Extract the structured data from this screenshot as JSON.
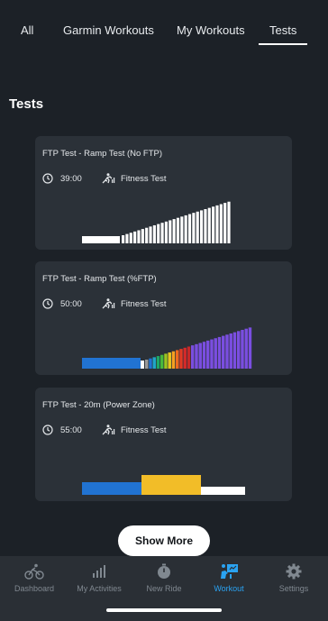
{
  "tabs": [
    {
      "label": "All",
      "active": false
    },
    {
      "label": "Garmin Workouts",
      "active": false
    },
    {
      "label": "My Workouts",
      "active": false
    },
    {
      "label": "Tests",
      "active": true
    }
  ],
  "section_title": "Tests",
  "workouts": [
    {
      "title": "FTP Test - Ramp Test (No FTP)",
      "duration": "39:00",
      "type": "Fitness Test",
      "profile": "ramp-white"
    },
    {
      "title": "FTP Test - Ramp Test (%FTP)",
      "duration": "50:00",
      "type": "Fitness Test",
      "profile": "ramp-zones"
    },
    {
      "title": "FTP Test - 20m (Power Zone)",
      "duration": "55:00",
      "type": "Fitness Test",
      "profile": "power-zone"
    }
  ],
  "show_more_label": "Show More",
  "bottom_nav": [
    {
      "label": "Dashboard",
      "icon": "cyclist-icon",
      "active": false
    },
    {
      "label": "My Activities",
      "icon": "bar-chart-icon",
      "active": false
    },
    {
      "label": "New Ride",
      "icon": "stopwatch-icon",
      "active": false
    },
    {
      "label": "Workout",
      "icon": "workout-icon",
      "active": true
    },
    {
      "label": "Settings",
      "icon": "gear-icon",
      "active": false
    }
  ],
  "colors": {
    "background": "#1c2127",
    "card": "#2b3138",
    "nav": "#2a2f35",
    "accent": "#2aa3f2",
    "zone_blue": "#2173d2",
    "zone_yellow": "#f2bd28",
    "zone_purple": "#7a4ee0"
  }
}
